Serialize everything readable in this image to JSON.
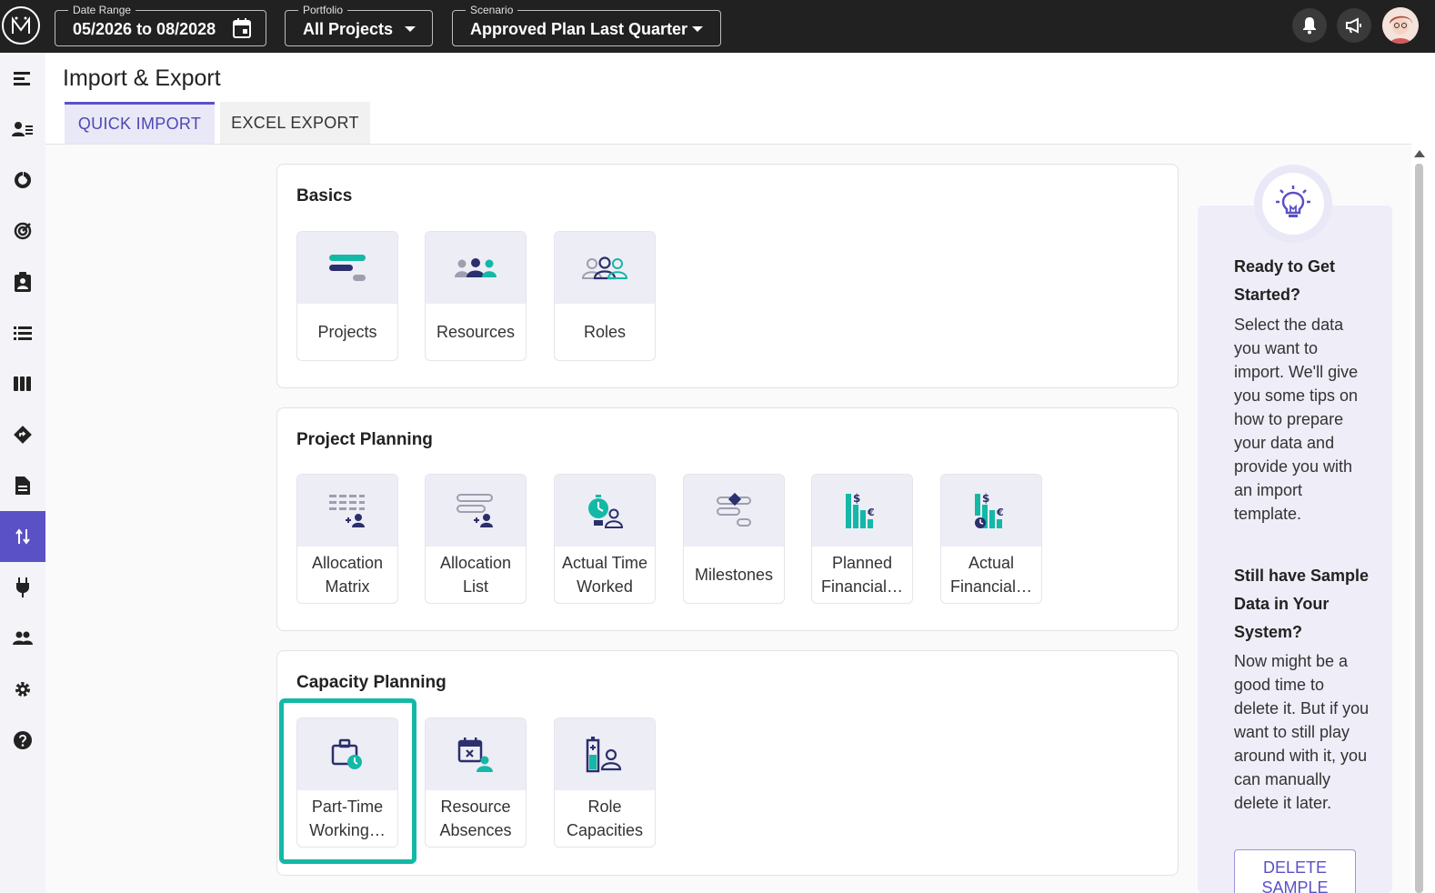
{
  "topbar": {
    "date_range": {
      "label": "Date Range",
      "value": "05/2026 to 08/2028"
    },
    "portfolio": {
      "label": "Portfolio",
      "value": "All Projects"
    },
    "scenario": {
      "label": "Scenario",
      "value": "Approved Plan Last Quarter"
    }
  },
  "page": {
    "title": "Import & Export",
    "tabs": [
      {
        "label": "QUICK IMPORT"
      },
      {
        "label": "EXCEL EXPORT"
      }
    ]
  },
  "sections": [
    {
      "title": "Basics",
      "cards": [
        {
          "label": "Projects",
          "icon": "projects-icon"
        },
        {
          "label": "Resources",
          "icon": "resources-icon"
        },
        {
          "label": "Roles",
          "icon": "roles-icon"
        }
      ]
    },
    {
      "title": "Project Planning",
      "cards": [
        {
          "label": "Allocation Matrix",
          "icon": "allocation-matrix-icon"
        },
        {
          "label": "Allocation List",
          "icon": "allocation-list-icon"
        },
        {
          "label": "Actual Time Worked",
          "icon": "actual-time-icon"
        },
        {
          "label": "Milestones",
          "icon": "milestones-icon"
        },
        {
          "label": "Planned Financial…",
          "icon": "planned-financial-icon"
        },
        {
          "label": "Actual Financial…",
          "icon": "actual-financial-icon"
        }
      ]
    },
    {
      "title": "Capacity Planning",
      "cards": [
        {
          "label": "Part-Time Working…",
          "icon": "part-time-icon"
        },
        {
          "label": "Resource Absences",
          "icon": "absences-icon"
        },
        {
          "label": "Role Capacities",
          "icon": "role-capacities-icon"
        }
      ]
    }
  ],
  "tips": {
    "heading1": "Ready to Get Started?",
    "text1": "Select the data you want to import. We'll give you some tips on how to prepare your data and provide you with an import template.",
    "heading2": "Still have Sample Data in Your System?",
    "text2": "Now might be a good time to delete it. But if you want to still play around with it, you can manually delete it later.",
    "button": "DELETE SAMPLE"
  },
  "colors": {
    "accent": "#5b51c6",
    "teal": "#14b8a6",
    "navy": "#2b2f6b"
  }
}
